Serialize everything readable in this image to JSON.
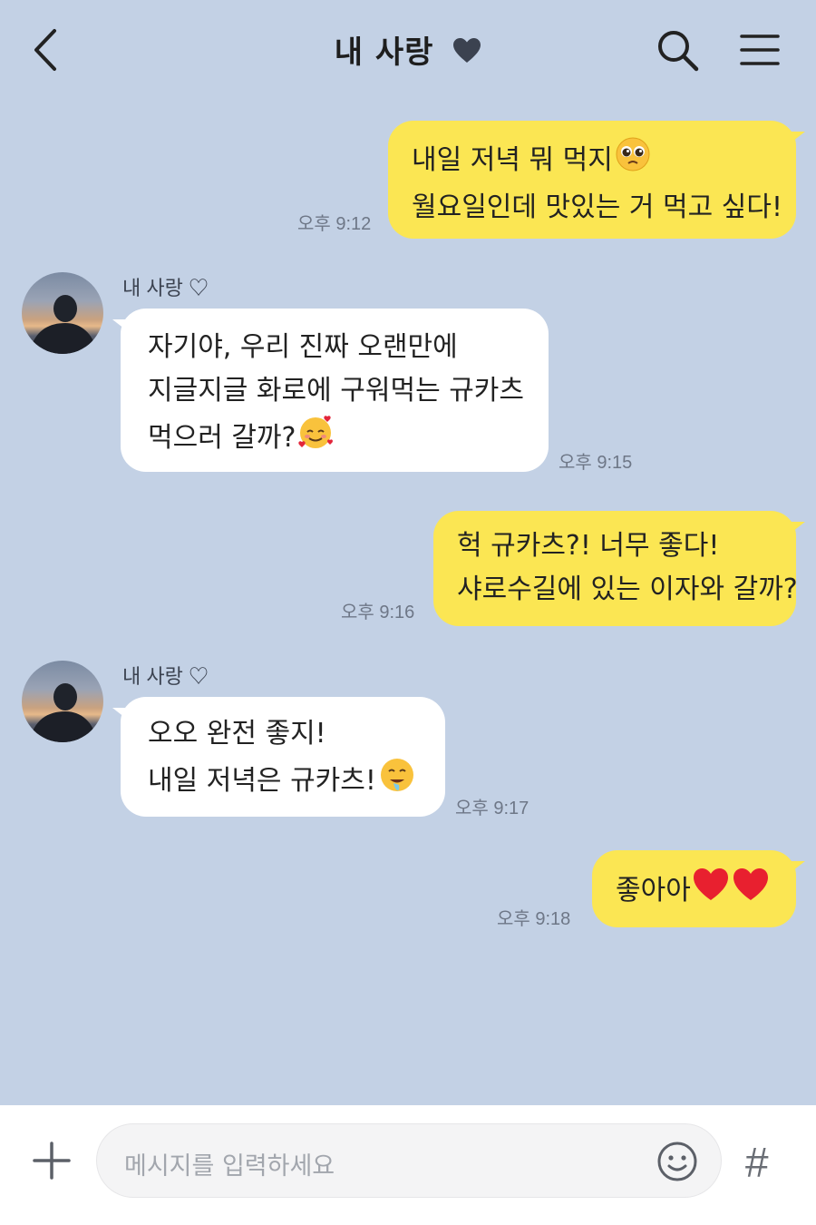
{
  "header": {
    "title": "내 사랑",
    "title_icon": "heart-icon",
    "back_icon": "chevron-left-icon",
    "search_icon": "search-icon",
    "menu_icon": "hamburger-menu-icon"
  },
  "messages": [
    {
      "from": "me",
      "lines": [
        "내일 저녁 뭐 먹지",
        "월요일인데 맛있는 거 먹고 싶다!"
      ],
      "emoji": "pleading-face-emoji",
      "time": "오후 9:12"
    },
    {
      "from": "them",
      "sender": "내 사랑 ♡",
      "lines": [
        "자기야, 우리 진짜 오랜만에",
        "지글지글 화로에 구워먹는 규카츠",
        "먹으러 갈까?"
      ],
      "emoji": "smiling-face-with-hearts-emoji",
      "time": "오후 9:15"
    },
    {
      "from": "me",
      "lines": [
        "헉 규카츠?! 너무 좋다!",
        "샤로수길에 있는 이자와 갈까?"
      ],
      "time": "오후 9:16"
    },
    {
      "from": "them",
      "sender": "내 사랑 ♡",
      "lines": [
        "오오 완전 좋지!",
        "내일 저녁은 규카츠!"
      ],
      "emoji": "drooling-face-emoji",
      "time": "오후 9:17"
    },
    {
      "from": "me",
      "lines": [
        "좋아아"
      ],
      "emoji": "red-heart-emoji",
      "time": "오후 9:18"
    }
  ],
  "input": {
    "placeholder": "메시지를 입력하세요",
    "plus_icon": "plus-icon",
    "emoji_icon": "smiley-icon",
    "hash_label": "#"
  },
  "colors": {
    "background": "#c3d1e5",
    "my_bubble": "#fbe653",
    "their_bubble": "#ffffff"
  }
}
